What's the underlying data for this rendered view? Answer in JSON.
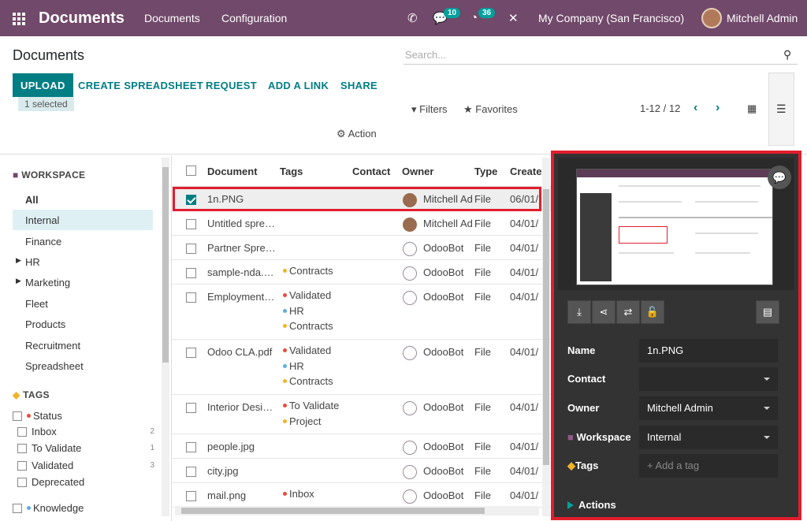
{
  "topbar": {
    "brand": "Documents",
    "menu": [
      "Documents",
      "Configuration"
    ],
    "messages_count": "10",
    "activities_count": "36",
    "company": "My Company (San Francisco)",
    "user": "Mitchell Admin"
  },
  "control": {
    "title": "Documents",
    "search_placeholder": "Search...",
    "buttons": [
      "UPLOAD",
      "CREATE SPREADSHEET",
      "REQUEST",
      "ADD A LINK",
      "SHARE"
    ],
    "selected": "1 selected",
    "filters": "Filters",
    "favorites": "Favorites",
    "pager": "1-12 / 12",
    "action": "Action"
  },
  "sidebar": {
    "workspace_header": "WORKSPACE",
    "workspaces": [
      "All",
      "Internal",
      "Finance",
      "HR",
      "Marketing",
      "Fleet",
      "Products",
      "Recruitment",
      "Spreadsheet"
    ],
    "tags_header": "TAGS",
    "status_label": "Status",
    "tags": [
      {
        "label": "Inbox",
        "count": "2"
      },
      {
        "label": "To Validate",
        "count": "1"
      },
      {
        "label": "Validated",
        "count": "3"
      },
      {
        "label": "Deprecated",
        "count": ""
      }
    ],
    "knowledge_label": "Knowledge"
  },
  "list": {
    "columns": [
      "Document",
      "Tags",
      "Contact",
      "Owner",
      "Type",
      "Created"
    ],
    "rows": [
      {
        "name": "1n.PNG",
        "tags": [],
        "owner": "Mitchell Ad",
        "type": "File",
        "created": "06/01/"
      },
      {
        "name": "Untitled spre…",
        "tags": [],
        "owner": "Mitchell Ad",
        "type": "File",
        "created": "04/01/"
      },
      {
        "name": "Partner Spre…",
        "tags": [],
        "owner": "OdooBot",
        "type": "File",
        "created": "04/01/"
      },
      {
        "name": "sample-nda.…",
        "tags": [
          "Contracts"
        ],
        "owner": "OdooBot",
        "type": "File",
        "created": "04/01/"
      },
      {
        "name": "Employment…",
        "tags": [
          "Validated",
          "HR",
          "Contracts"
        ],
        "owner": "OdooBot",
        "type": "File",
        "created": "04/01/"
      },
      {
        "name": "Odoo CLA.pdf",
        "tags": [
          "Validated",
          "HR",
          "Contracts"
        ],
        "owner": "OdooBot",
        "type": "File",
        "created": "04/01/"
      },
      {
        "name": "Interior Desi…",
        "tags": [
          "To Validate",
          "Project"
        ],
        "owner": "OdooBot",
        "type": "File",
        "created": "04/01/"
      },
      {
        "name": "people.jpg",
        "tags": [],
        "owner": "OdooBot",
        "type": "File",
        "created": "04/01/"
      },
      {
        "name": "city.jpg",
        "tags": [],
        "owner": "OdooBot",
        "type": "File",
        "created": "04/01/"
      },
      {
        "name": "mail.png",
        "tags": [
          "Inbox"
        ],
        "owner": "OdooBot",
        "type": "File",
        "created": "04/01/"
      }
    ]
  },
  "tag_colors": {
    "Contracts": "#f0b429",
    "Validated": "#e74c3c",
    "HR": "#5dade2",
    "Project": "#f0b429",
    "To Validate": "#e74c3c",
    "Inbox": "#e74c3c"
  },
  "panel": {
    "name_label": "Name",
    "name_value": "1n.PNG",
    "contact_label": "Contact",
    "contact_value": "",
    "owner_label": "Owner",
    "owner_value": "Mitchell Admin",
    "workspace_label": "Workspace",
    "workspace_value": "Internal",
    "tags_label": "Tags",
    "tags_placeholder": "+ Add a tag",
    "actions_label": "Actions"
  },
  "colors": {
    "brand": "#71496a",
    "accent": "#017e84",
    "highlight": "#e01e2d"
  }
}
